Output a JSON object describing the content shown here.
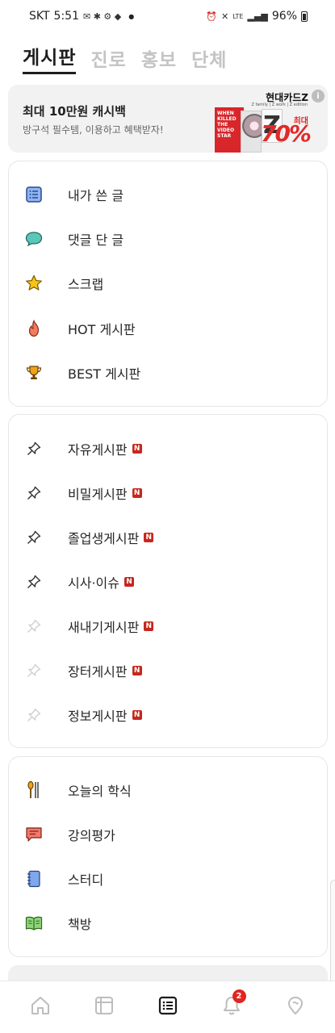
{
  "status_bar": {
    "carrier": "SKT",
    "time": "5:51",
    "network": "LTE",
    "battery": "96%"
  },
  "tabs": [
    {
      "label": "게시판",
      "active": true
    },
    {
      "label": "진로",
      "active": false
    },
    {
      "label": "홍보",
      "active": false
    },
    {
      "label": "단체",
      "active": false
    }
  ],
  "banner": {
    "title": "최대 10만원 캐시백",
    "subtitle": "방구석 필수템, 이용하고 혜택받자!",
    "brand": "현대카드Z",
    "brand_sub": "Z family | Z work | Z edition",
    "promo_max": "최대",
    "promo_percent": "70%",
    "book_text": "WHEN KILLED THE VIDEO STAR"
  },
  "my_menu": [
    {
      "label": "내가 쓴 글",
      "icon": "list-icon"
    },
    {
      "label": "댓글 단 글",
      "icon": "speech-bubble-icon"
    },
    {
      "label": "스크랩",
      "icon": "star-icon"
    },
    {
      "label": "HOT 게시판",
      "icon": "fire-icon"
    },
    {
      "label": "BEST 게시판",
      "icon": "trophy-icon"
    }
  ],
  "boards": [
    {
      "label": "자유게시판",
      "pinned": true,
      "badge": "N"
    },
    {
      "label": "비밀게시판",
      "pinned": true,
      "badge": "N"
    },
    {
      "label": "졸업생게시판",
      "pinned": true,
      "badge": "N"
    },
    {
      "label": "시사·이슈",
      "pinned": true,
      "badge": "N"
    },
    {
      "label": "새내기게시판",
      "pinned": false,
      "badge": "N"
    },
    {
      "label": "장터게시판",
      "pinned": false,
      "badge": "N"
    },
    {
      "label": "정보게시판",
      "pinned": false,
      "badge": "N"
    }
  ],
  "services": [
    {
      "label": "오늘의 학식",
      "icon": "utensils-icon"
    },
    {
      "label": "강의평가",
      "icon": "review-icon"
    },
    {
      "label": "스터디",
      "icon": "notebook-icon"
    },
    {
      "label": "책방",
      "icon": "book-icon"
    }
  ],
  "bottom_nav": {
    "notification_count": "2"
  },
  "colors": {
    "accent_red": "#c6281e",
    "active_text": "#1e1e1e",
    "inactive_tab": "#c4c4c4"
  }
}
